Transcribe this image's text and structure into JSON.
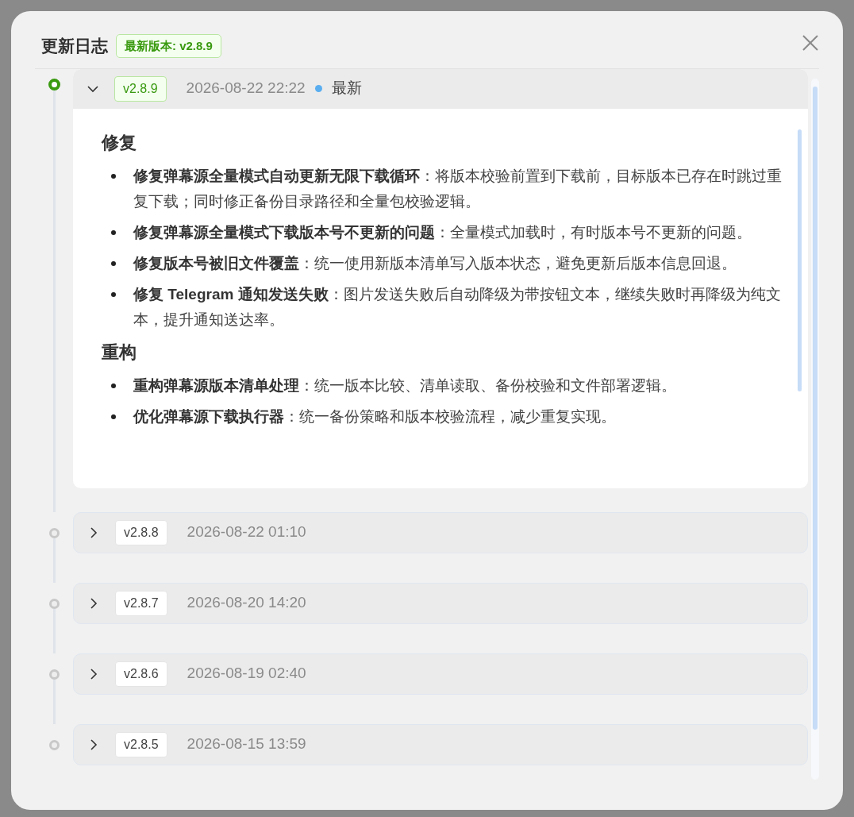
{
  "dialog": {
    "title": "更新日志",
    "latest_badge": "最新版本: v2.8.9"
  },
  "releases": [
    {
      "version": "v2.8.9",
      "date": "2026-08-22 22:22",
      "latest_label": "最新",
      "expanded": true,
      "current": true,
      "sections": [
        {
          "heading": "修复",
          "items": [
            "**修复弹幕源全量模式自动更新无限下载循环**：将版本校验前置到下载前，目标版本已存在时跳过重复下载；同时修正备份目录路径和全量包校验逻辑。",
            "**修复弹幕源全量模式下载版本号不更新的问题**：全量模式加载时，有时版本号不更新的问题。",
            "**修复版本号被旧文件覆盖**：统一使用新版本清单写入版本状态，避免更新后版本信息回退。",
            "**修复 Telegram 通知发送失败**：图片发送失败后自动降级为带按钮文本，继续失败时再降级为纯文本，提升通知送达率。"
          ]
        },
        {
          "heading": "重构",
          "items": [
            "**重构弹幕源版本清单处理**：统一版本比较、清单读取、备份校验和文件部署逻辑。",
            "**优化弹幕源下载执行器**：统一备份策略和版本校验流程，减少重复实现。"
          ]
        }
      ]
    },
    {
      "version": "v2.8.8",
      "date": "2026-08-22 01:10",
      "expanded": false,
      "current": false
    },
    {
      "version": "v2.8.7",
      "date": "2026-08-20 14:20",
      "expanded": false,
      "current": false
    },
    {
      "version": "v2.8.6",
      "date": "2026-08-19 02:40",
      "expanded": false,
      "current": false
    },
    {
      "version": "v2.8.5",
      "date": "2026-08-15 13:59",
      "expanded": false,
      "current": false
    }
  ]
}
